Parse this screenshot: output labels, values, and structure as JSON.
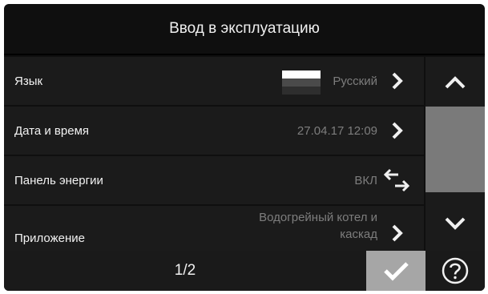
{
  "header": {
    "title": "Ввод в эксплуатацию"
  },
  "rows": [
    {
      "label": "Язык",
      "value": "Русский",
      "icon": "chevron-right-icon",
      "flag": "russian-flag-icon"
    },
    {
      "label": "Дата и время",
      "value": "27.04.17 12:09",
      "icon": "chevron-right-icon"
    },
    {
      "label": "Панель энергии",
      "value": "ВКЛ",
      "icon": "swap-arrows-icon"
    },
    {
      "label": "Приложение",
      "value_line1": "Водогрейный котел и",
      "value_line2": "каскад",
      "icon": "chevron-right-icon"
    }
  ],
  "footer": {
    "page": "1/2"
  },
  "icons": {
    "scroll_up": "chevron-up-icon",
    "scroll_down": "chevron-down-icon",
    "confirm": "checkmark-icon",
    "help": "question-icon"
  },
  "colors": {
    "background": "#0f0f0f",
    "row": "#1b1b1b",
    "value_text": "#7d7d7d",
    "confirm_button": "#a6a6a6"
  }
}
